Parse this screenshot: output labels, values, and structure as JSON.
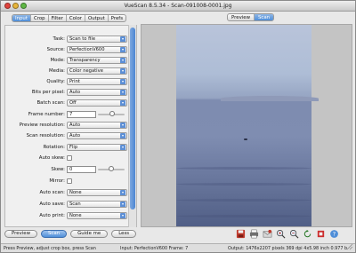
{
  "window": {
    "title": "VueScan 8.5.34 - Scan-091008-0001.jpg"
  },
  "tabs": [
    {
      "label": "Input",
      "active": true
    },
    {
      "label": "Crop",
      "active": false
    },
    {
      "label": "Filter",
      "active": false
    },
    {
      "label": "Color",
      "active": false
    },
    {
      "label": "Output",
      "active": false
    },
    {
      "label": "Prefs",
      "active": false
    }
  ],
  "form": {
    "task": {
      "label": "Task:",
      "value": "Scan to file"
    },
    "source": {
      "label": "Source:",
      "value": "PerfectionV600"
    },
    "mode": {
      "label": "Mode:",
      "value": "Transparency"
    },
    "media": {
      "label": "Media:",
      "value": "Color negative"
    },
    "quality": {
      "label": "Quality:",
      "value": "Print"
    },
    "bits": {
      "label": "Bits per pixel:",
      "value": "Auto"
    },
    "batch": {
      "label": "Batch scan:",
      "value": "Off"
    },
    "frame": {
      "label": "Frame number:",
      "value": "7"
    },
    "preview_res": {
      "label": "Preview resolution:",
      "value": "Auto"
    },
    "scan_res": {
      "label": "Scan resolution:",
      "value": "Auto"
    },
    "rotation": {
      "label": "Rotation:",
      "value": "Flip"
    },
    "auto_skew": {
      "label": "Auto skew:"
    },
    "skew": {
      "label": "Skew:",
      "value": "0"
    },
    "mirror": {
      "label": "Mirror:"
    },
    "auto_scan": {
      "label": "Auto scan:",
      "value": "None"
    },
    "auto_save": {
      "label": "Auto save:",
      "value": "Scan"
    },
    "auto_print": {
      "label": "Auto print:",
      "value": "None"
    }
  },
  "buttons": {
    "preview": "Preview",
    "scan": "Scan",
    "guide": "Guide me",
    "less": "Less"
  },
  "status": {
    "left": "Press Preview, adjust crop box, press Scan",
    "middle": "Input: PerfectionV600 Frame: 7",
    "right": "Output: 1476x2207 pixels 369 dpi 4x5.98 inch 0.977 b"
  },
  "preview_tabs": [
    {
      "label": "Preview",
      "active": false
    },
    {
      "label": "Scan",
      "active": true
    }
  ],
  "toolbar_icons": [
    "save-icon",
    "print-icon",
    "email-icon",
    "zoom-in-icon",
    "zoom-out-icon",
    "rotate-icon",
    "crop-icon",
    "help-icon"
  ],
  "colors": {
    "accent": "#4f8ed8",
    "sky": "#b9c4da",
    "sea": "#6f7da3"
  }
}
